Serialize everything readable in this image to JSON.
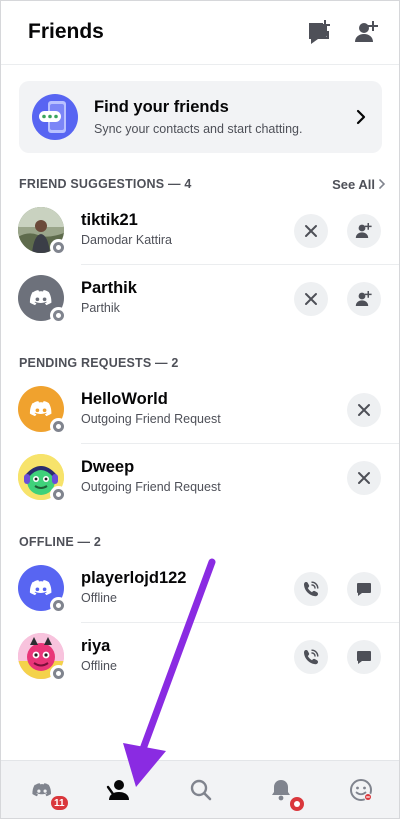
{
  "header": {
    "title": "Friends",
    "icons": [
      "new-message-icon",
      "add-friend-icon"
    ]
  },
  "find_card": {
    "title": "Find your friends",
    "subtitle": "Sync your contacts and start chatting."
  },
  "suggestions": {
    "header": "FRIEND SUGGESTIONS — 4",
    "see_all": "See All",
    "items": [
      {
        "name": "tiktik21",
        "sub": "Damodar Kattira"
      },
      {
        "name": "Parthik",
        "sub": "Parthik"
      }
    ]
  },
  "pending": {
    "header": "PENDING REQUESTS — 2",
    "items": [
      {
        "name": "HelloWorld",
        "sub": "Outgoing Friend Request"
      },
      {
        "name": "Dweep",
        "sub": "Outgoing Friend Request"
      }
    ]
  },
  "offline": {
    "header": "OFFLINE — 2",
    "items": [
      {
        "name": "playerlojd122",
        "sub": "Offline"
      },
      {
        "name": "riya",
        "sub": "Offline"
      }
    ]
  },
  "bottom_nav": {
    "home_badge": "11",
    "items": [
      "home-icon",
      "friends-icon",
      "search-icon",
      "notifications-icon",
      "profile-icon"
    ]
  },
  "colors": {
    "blurple": "#5865f2",
    "orange_avatar": "#f0a22e",
    "grey_avatar": "#6d717b",
    "annotation_arrow": "#8a2be2",
    "badge_red": "#da373c"
  }
}
